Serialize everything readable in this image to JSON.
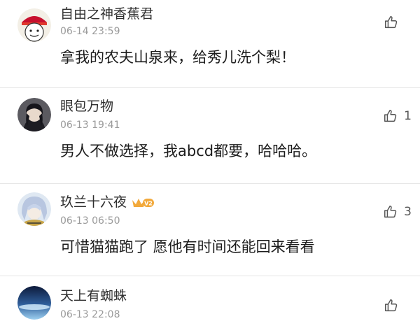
{
  "comments": [
    {
      "username": "自由之神香蕉君",
      "timestamp": "06-14 23:59",
      "content": "拿我的农夫山泉来，给秀儿洗个梨！",
      "likes": ""
    },
    {
      "username": "眼包万物",
      "timestamp": "06-13 19:41",
      "content": "男人不做选择，我abcd都要，哈哈哈。",
      "likes": "1"
    },
    {
      "username": "玖兰十六夜",
      "timestamp": "06-13 06:50",
      "content": "可惜猫猫跑了 愿他有时间还能回来看看",
      "likes": "3",
      "badge": "V2"
    },
    {
      "username": "天上有蜘蛛",
      "timestamp": "06-13 22:08",
      "content": "",
      "likes": ""
    }
  ],
  "icons": {
    "like": "thumbs-up-icon"
  },
  "colors": {
    "badge_gold": "#f2a93b",
    "divider": "#e6e6e6"
  }
}
